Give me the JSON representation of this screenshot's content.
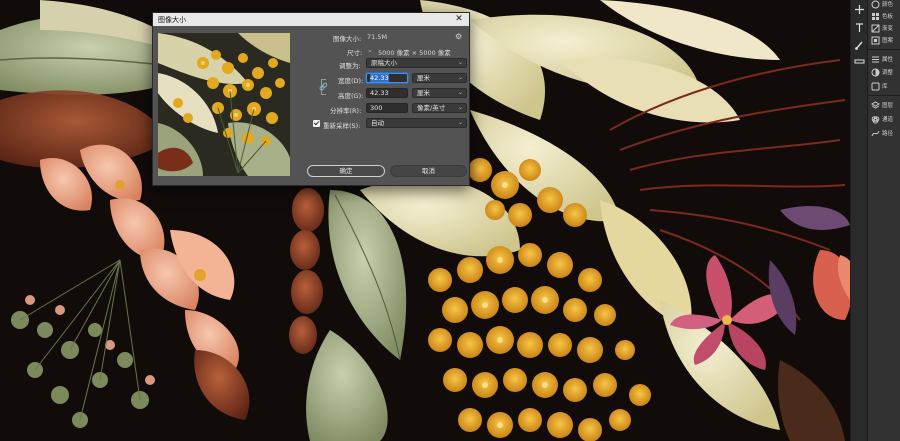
{
  "dialog": {
    "title": "图像大小",
    "close_symbol": "✕",
    "image_size_label": "图像大小:",
    "image_size_value": "71.5M",
    "dimensions_label": "尺寸:",
    "dimensions_value": "5000 像素 × 5000 像素",
    "fit_to_label": "调整为:",
    "fit_to_value": "原稿大小",
    "width_label": "宽度(D):",
    "width_value": "42.33",
    "width_unit": "厘米",
    "height_label": "高度(G):",
    "height_value": "42.33",
    "height_unit": "厘米",
    "resolution_label": "分辨率(R):",
    "resolution_value": "300",
    "resolution_unit": "像素/英寸",
    "resample_label": "重新采样(S):",
    "resample_checked": true,
    "resample_value": "自动",
    "ok_label": "确定",
    "cancel_label": "取消"
  },
  "panels": {
    "items": [
      {
        "label": "颜色",
        "icon": "color-wheel-icon"
      },
      {
        "label": "色板",
        "icon": "swatches-icon"
      },
      {
        "label": "渐变",
        "icon": "gradient-icon"
      },
      {
        "label": "图案",
        "icon": "pattern-icon"
      },
      {
        "label": "属性",
        "icon": "properties-icon"
      },
      {
        "label": "调整",
        "icon": "adjustments-icon"
      },
      {
        "label": "库",
        "icon": "library-icon"
      },
      {
        "label": "图层",
        "icon": "layers-icon"
      },
      {
        "label": "通道",
        "icon": "channels-icon"
      },
      {
        "label": "路径",
        "icon": "paths-icon"
      }
    ]
  },
  "colors": {
    "accent": "#2f6ecb",
    "dialog_bg": "#535353",
    "panel_bg": "#323232"
  }
}
